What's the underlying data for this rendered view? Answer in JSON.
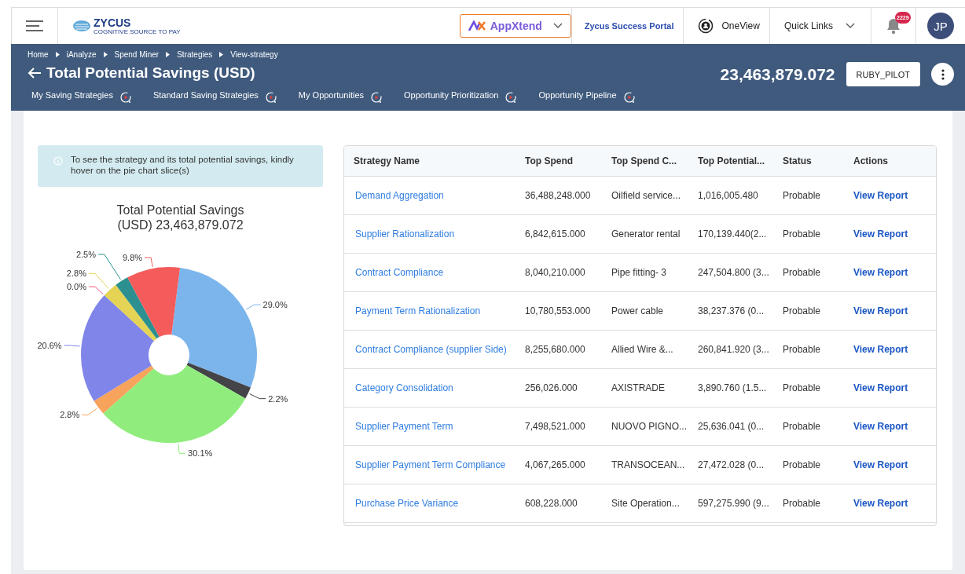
{
  "header": {
    "logo": "ZYCUS",
    "logo_tagline": "COGNITIVE SOURCE TO PAY",
    "app_switcher": "AppXtend",
    "success_portal": "Zycus Success Portal",
    "oneview": "OneView",
    "quick_links": "Quick Links",
    "notification_count": "2229",
    "avatar": "JP"
  },
  "breadcrumbs": [
    "Home",
    "iAnalyze",
    "Spend Miner",
    "Strategies",
    "View-strategy"
  ],
  "page_title": "Total Potential Savings (USD)",
  "total": "23,463,879.072",
  "user_button": "RUBY_PILOT",
  "tabs": [
    {
      "label": "My Saving Strategies"
    },
    {
      "label": "Standard Saving Strategies"
    },
    {
      "label": "My Opportunities"
    },
    {
      "label": "Opportunity Prioritization"
    },
    {
      "label": "Opportunity Pipeline"
    }
  ],
  "info": "To see the strategy and its total potential savings, kindly hover on the pie chart slice(s)",
  "chart_data": {
    "type": "donut",
    "title": "Total Potential Savings (USD) 23,463,879.072",
    "value_labels": [
      "29.0%",
      "2.2%",
      "30.1%",
      "2.8%",
      "20.6%",
      "0.0%",
      "2.8%",
      "2.5%",
      "9.8%"
    ],
    "series": [
      {
        "values": [
          29.0,
          2.2,
          30.1,
          2.8,
          20.6,
          0.0,
          2.8,
          2.5,
          9.8
        ],
        "colors": [
          "#7cb5ec",
          "#434348",
          "#90ed7d",
          "#f7a35c",
          "#8085e9",
          "#f15c80",
          "#e4d354",
          "#2b908f",
          "#f45b5b"
        ]
      }
    ]
  },
  "table": {
    "columns": [
      "Strategy Name",
      "Top Spend",
      "Top Spend C...",
      "Top Potential...",
      "Status",
      "Actions"
    ],
    "rows": [
      {
        "name": "Demand Aggregation",
        "spend": "36,488,248.000",
        "category": "Oilfield service...",
        "potential": "1,016,005.480",
        "status": "Probable",
        "action": "View Report"
      },
      {
        "name": "Supplier Rationalization",
        "spend": "6,842,615.000",
        "category": "Generator rental",
        "potential": "170,139.440(2...",
        "status": "Probable",
        "action": "View Report"
      },
      {
        "name": "Contract Compliance",
        "spend": "8,040,210.000",
        "category": "Pipe fitting- 3",
        "potential": "247,504.800 (3...",
        "status": "Probable",
        "action": "View Report"
      },
      {
        "name": "Payment Term Rationalization",
        "spend": "10,780,553.000",
        "category": "Power cable",
        "potential": "38,237.376 (0...",
        "status": "Probable",
        "action": "View Report"
      },
      {
        "name": "Contract Compliance (supplier Side)",
        "spend": "8,255,680.000",
        "category": "Allied Wire &...",
        "potential": "260,841.920 (3...",
        "status": "Probable",
        "action": "View Report"
      },
      {
        "name": "Category Consolidation",
        "spend": "256,026.000",
        "category": "AXISTRADE",
        "potential": "3,890.760 (1.5...",
        "status": "Probable",
        "action": "View Report"
      },
      {
        "name": "Supplier Payment Term",
        "spend": "7,498,521.000",
        "category": "NUOVO PIGNO...",
        "potential": "25,636.041 (0...",
        "status": "Probable",
        "action": "View Report"
      },
      {
        "name": "Supplier Payment Term Compliance",
        "spend": "4,067,265.000",
        "category": "TRANSOCEAN...",
        "potential": "27,472.028 (0...",
        "status": "Probable",
        "action": "View Report"
      },
      {
        "name": "Purchase Price Variance",
        "spend": "608,228.000",
        "category": "Site Operation...",
        "potential": "597,275.990 (9...",
        "status": "Probable",
        "action": "View Report"
      }
    ]
  }
}
